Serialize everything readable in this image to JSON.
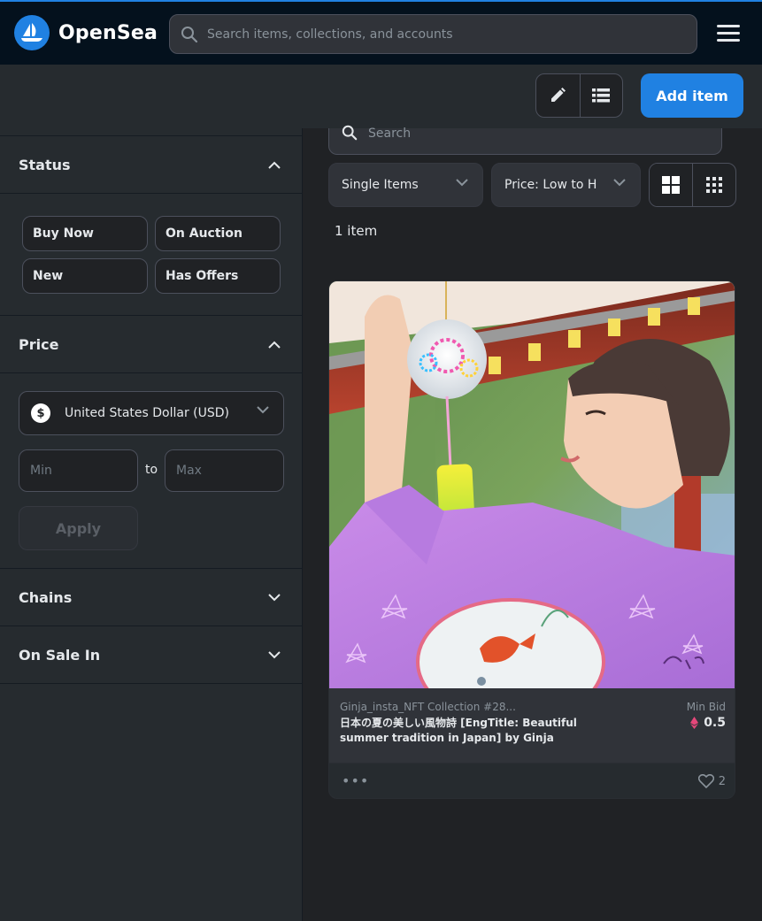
{
  "header": {
    "brand": "OpenSea",
    "search_placeholder": "Search items, collections, and accounts"
  },
  "toolbar": {
    "add_item_label": "Add item"
  },
  "sidebar": {
    "status": {
      "title": "Status",
      "chips": [
        "Buy Now",
        "On Auction",
        "New",
        "Has Offers"
      ]
    },
    "price": {
      "title": "Price",
      "currency": "United States Dollar (USD)",
      "currency_symbol": "$",
      "min_placeholder": "Min",
      "to_label": "to",
      "max_placeholder": "Max",
      "apply_label": "Apply"
    },
    "chains": {
      "title": "Chains"
    },
    "on_sale_in": {
      "title": "On Sale In"
    }
  },
  "main": {
    "search_placeholder": "Search",
    "item_type": "Single Items",
    "sort": "Price: Low to High",
    "item_count": "1 item"
  },
  "card": {
    "collection": "Ginja_insta_NFT Collection #28...",
    "name": "日本の夏の美しい風物詩 [EngTitle: Beautiful summer tradition in Japan] by Ginja",
    "min_bid_label": "Min Bid",
    "price": "0.5",
    "likes": "2",
    "more": "•••"
  },
  "colors": {
    "accent": "#2081e2",
    "nav_bg": "#04111d",
    "panel_bg": "#262b2f",
    "surface": "#303339",
    "border": "#4c505c"
  }
}
